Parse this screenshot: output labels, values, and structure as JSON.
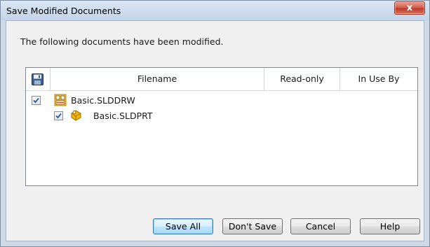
{
  "window": {
    "title": "Save Modified Documents",
    "close_label": "x"
  },
  "message": "The following documents have been modified.",
  "table": {
    "save_column_icon": "save-icon",
    "columns": [
      "Filename",
      "Read-only",
      "In Use By"
    ],
    "rows": [
      {
        "checked": true,
        "icon": "drawing-icon",
        "name": "Basic.SLDDRW",
        "level": 0
      },
      {
        "checked": true,
        "icon": "part-icon",
        "name": "Basic.SLDPRT",
        "level": 1
      }
    ]
  },
  "buttons": {
    "save_all": "Save All",
    "dont_save": "Don't Save",
    "cancel": "Cancel",
    "help": "Help"
  },
  "colors": {
    "accent": "#3c7fb1",
    "close_button": "#c0392b"
  }
}
